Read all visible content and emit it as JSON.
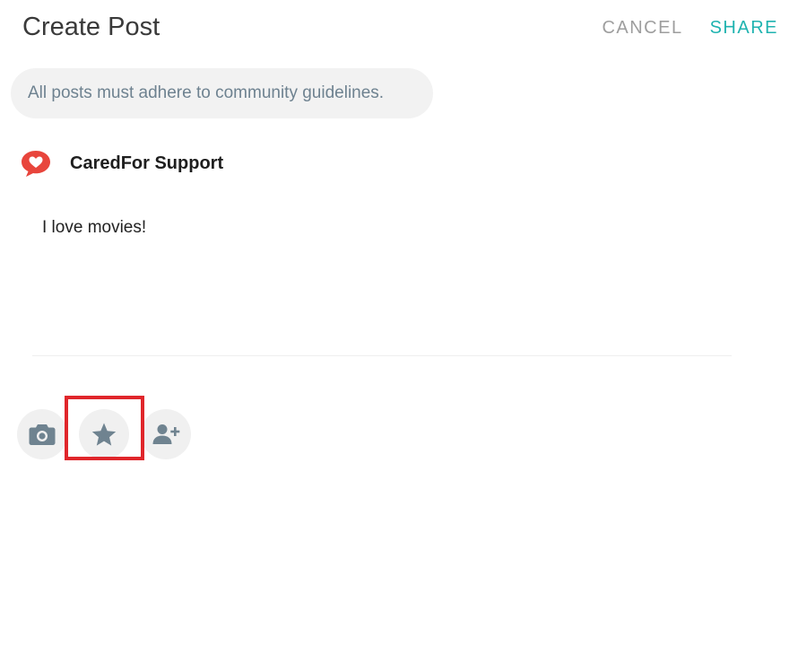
{
  "header": {
    "title": "Create Post",
    "cancel_label": "CANCEL",
    "share_label": "SHARE"
  },
  "notice": {
    "text": "All posts must adhere to community guidelines."
  },
  "author": {
    "name": "CaredFor Support",
    "icon": "heart-chat-logo-icon"
  },
  "post": {
    "text": "I love movies!"
  },
  "toolbar": {
    "items": [
      {
        "icon": "camera-icon"
      },
      {
        "icon": "star-icon"
      },
      {
        "icon": "add-person-icon"
      }
    ]
  },
  "colors": {
    "accent": "#1fb3b0",
    "logo": "#e8453c",
    "icon": "#6f8390",
    "highlight": "#e0262b"
  }
}
